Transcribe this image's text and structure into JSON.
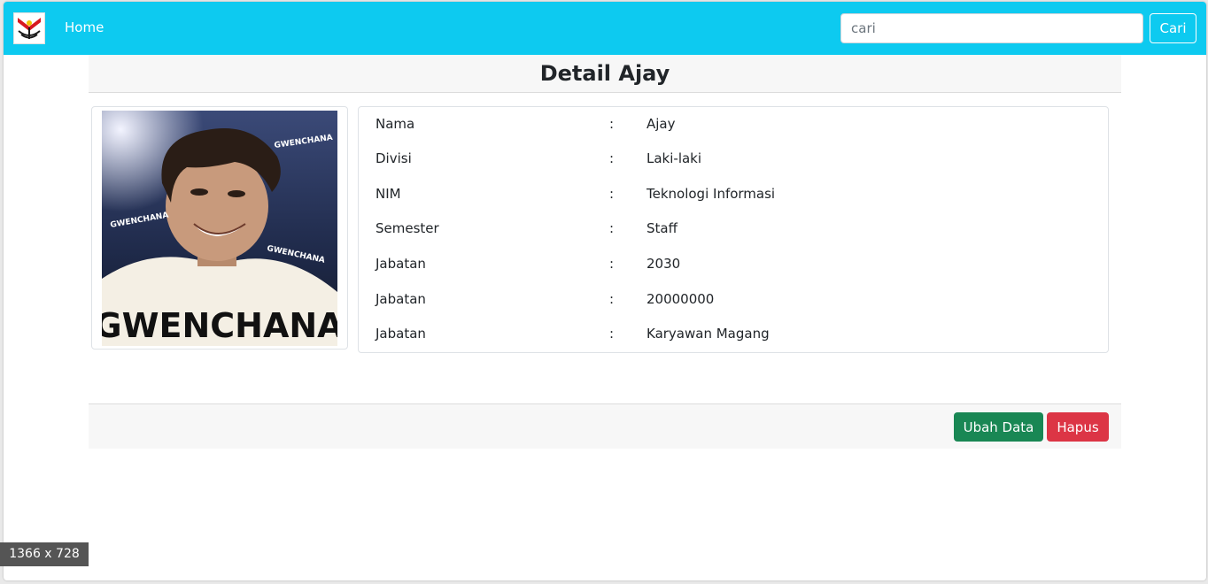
{
  "navbar": {
    "logo_icon": "university-logo-icon",
    "home_label": "Home",
    "search_placeholder": "cari",
    "search_value": "",
    "search_button_label": "Cari",
    "background": "#0dcaf0"
  },
  "page": {
    "title": "Detail Ajay"
  },
  "photo": {
    "caption_big": "GWENCHANA",
    "caption_small": "GWENCHANA"
  },
  "details": {
    "separator": ":",
    "rows": [
      {
        "label": "Nama",
        "value": "Ajay"
      },
      {
        "label": "Divisi",
        "value": "Laki-laki"
      },
      {
        "label": "NIM",
        "value": "Teknologi Informasi"
      },
      {
        "label": "Semester",
        "value": "Staff"
      },
      {
        "label": "Jabatan",
        "value": "2030"
      },
      {
        "label": "Jabatan",
        "value": "20000000"
      },
      {
        "label": "Jabatan",
        "value": "Karyawan Magang"
      }
    ]
  },
  "footer": {
    "edit_label": "Ubah Data",
    "delete_label": "Hapus",
    "edit_color": "#198754",
    "delete_color": "#dc3545"
  },
  "overlay": {
    "viewport_size": "1366 x 728"
  }
}
